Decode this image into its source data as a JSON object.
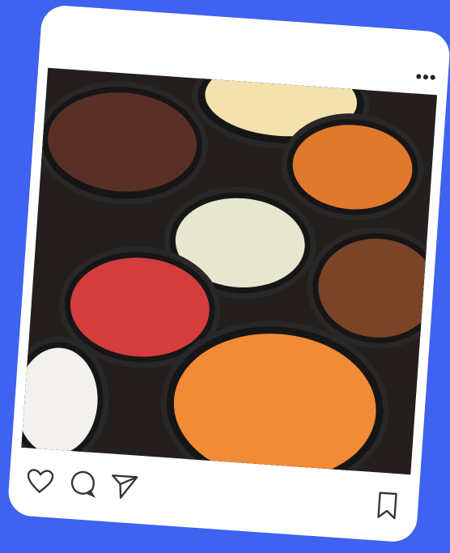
{
  "post": {
    "menu_icon": "more-dots-icon",
    "menu_text": "•••",
    "image_subject": "food-buffet-photo",
    "actions": {
      "like_icon": "heart-icon",
      "comment_icon": "comment-bubble-icon",
      "share_icon": "paper-plane-icon",
      "save_icon": "bookmark-icon"
    }
  },
  "colors": {
    "background": "#3f63f0",
    "card": "#ffffff"
  }
}
